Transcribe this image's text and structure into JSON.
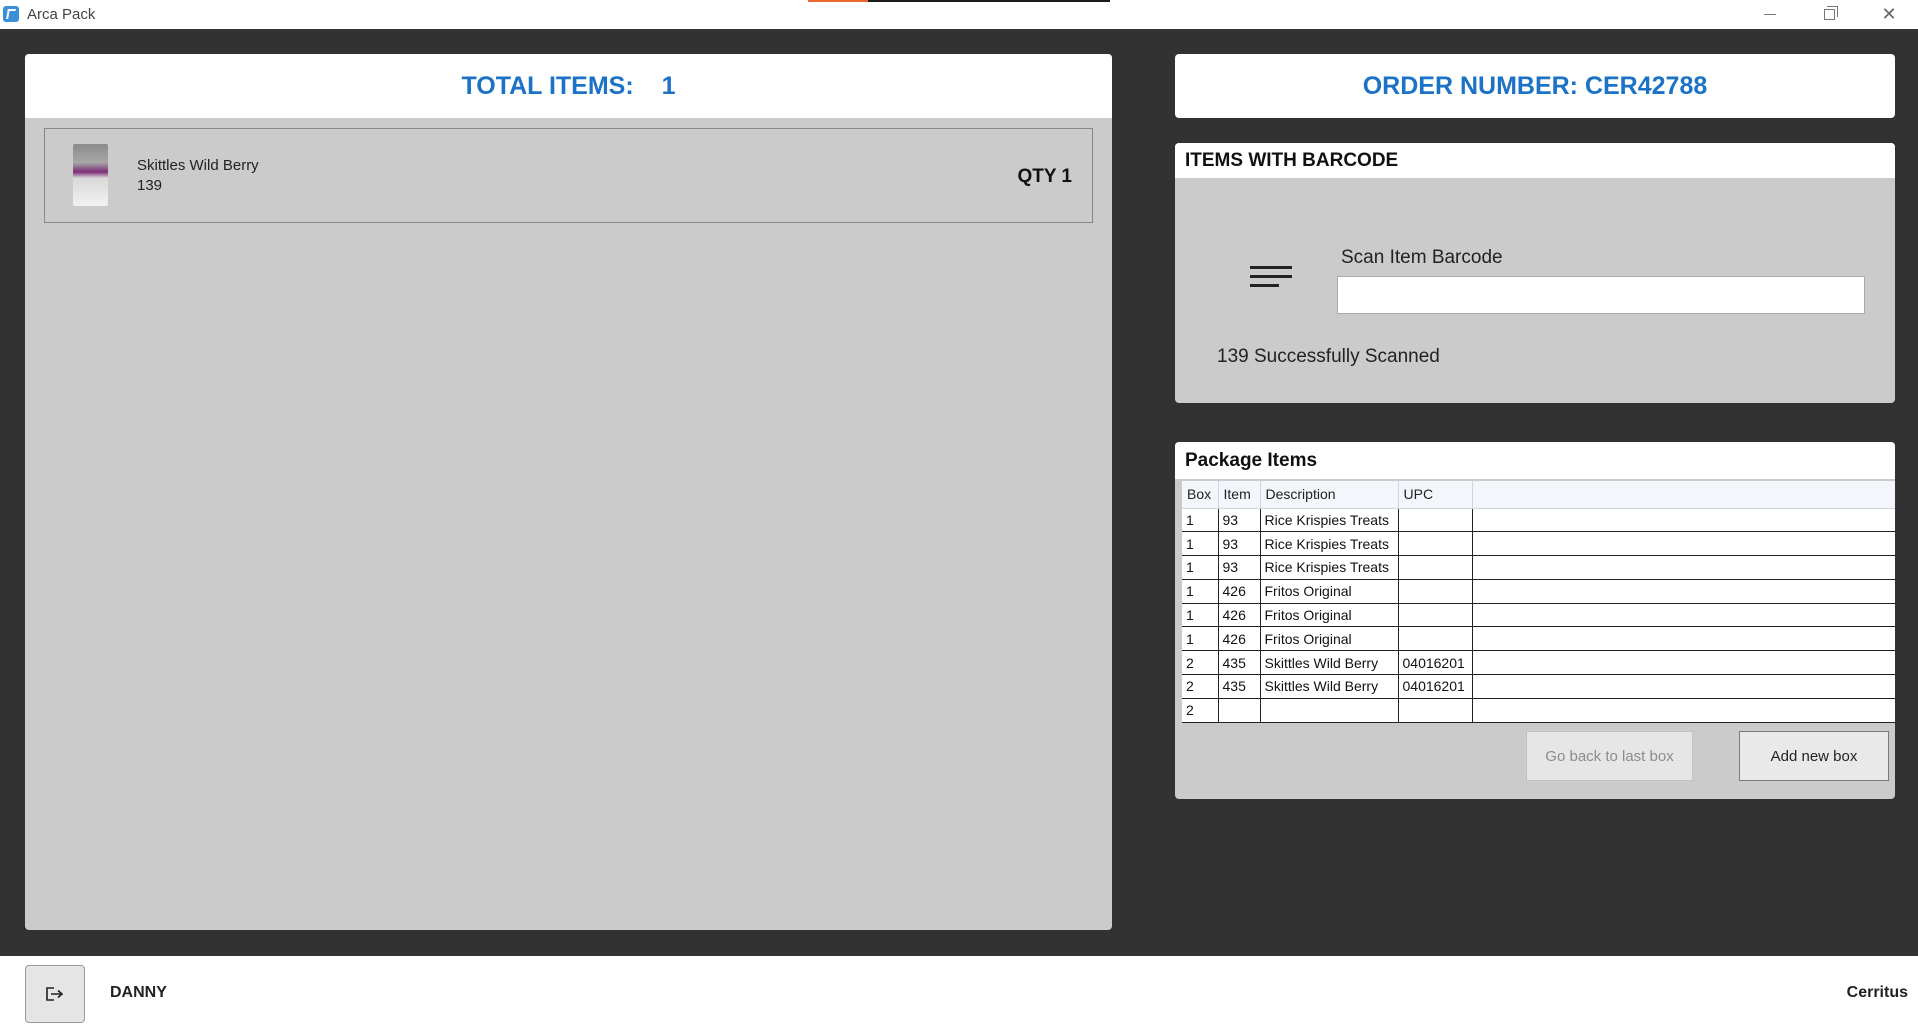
{
  "window": {
    "title": "Arca Pack",
    "icon": "arca-pack-app-icon",
    "progress_fraction": 0.2,
    "accent_color": "#1b72c6",
    "progress_color": "#e8672b"
  },
  "left": {
    "total_label": "TOTAL ITEMS:",
    "total_value": "1",
    "items": [
      {
        "name": "Skittles Wild Berry",
        "code": "139",
        "qty": "QTY 1",
        "thumbnail": "product-thumbnail"
      }
    ]
  },
  "order": {
    "label": "ORDER NUMBER: CER42788"
  },
  "barcode": {
    "title": "ITEMS WITH BARCODE",
    "scan_label": "Scan Item Barcode",
    "scan_value": "",
    "status": "139 Successfully Scanned",
    "icon": "menu-lines-icon"
  },
  "package": {
    "title": "Package Items",
    "columns": [
      "Box",
      "Item",
      "Description",
      "UPC"
    ],
    "rows": [
      [
        "1",
        "93",
        "Rice Krispies Treats",
        ""
      ],
      [
        "1",
        "93",
        "Rice Krispies Treats",
        ""
      ],
      [
        "1",
        "93",
        "Rice Krispies Treats",
        ""
      ],
      [
        "1",
        "426",
        "Fritos Original",
        ""
      ],
      [
        "1",
        "426",
        "Fritos Original",
        ""
      ],
      [
        "1",
        "426",
        "Fritos Original",
        ""
      ],
      [
        "2",
        "435",
        "Skittles Wild Berry",
        "04016201"
      ],
      [
        "2",
        "435",
        "Skittles Wild Berry",
        "04016201"
      ],
      [
        "2",
        "",
        "",
        ""
      ]
    ],
    "back_button": "Go back to last box",
    "add_button": "Add new box"
  },
  "footer": {
    "user": "DANNY",
    "brand": "Cerritus",
    "logout_icon": "logout-icon"
  }
}
